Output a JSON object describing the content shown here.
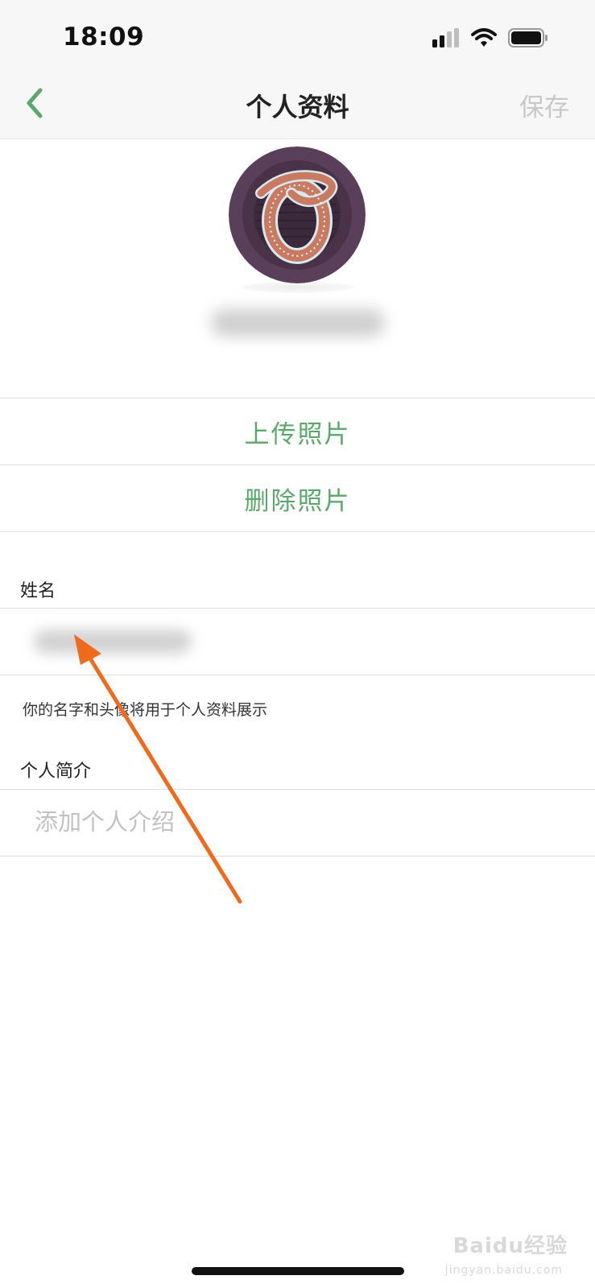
{
  "status_bar": {
    "time": "18:09",
    "icons": [
      "cellular-signal-icon",
      "wifi-icon",
      "battery-icon"
    ]
  },
  "nav": {
    "back_icon": "chevron-left-icon",
    "title": "个人资料",
    "save_label": "保存"
  },
  "profile": {
    "avatar_icon": "monogram-o-avatar"
  },
  "actions": {
    "upload_label": "上传照片",
    "delete_label": "删除照片"
  },
  "form": {
    "name_label": "姓名",
    "hint": "你的名字和头像将用于个人资料展示",
    "bio_label": "个人简介",
    "bio_placeholder": "添加个人介绍",
    "bio_value": ""
  },
  "watermark": {
    "text": "Baidu经验",
    "sub": "jingyan.baidu.com"
  },
  "colors": {
    "accent_green": "#5aa96b",
    "save_disabled": "#c8c8c8",
    "annotation_arrow": "#f06a1d",
    "nav_background": "#f7f7f7"
  }
}
